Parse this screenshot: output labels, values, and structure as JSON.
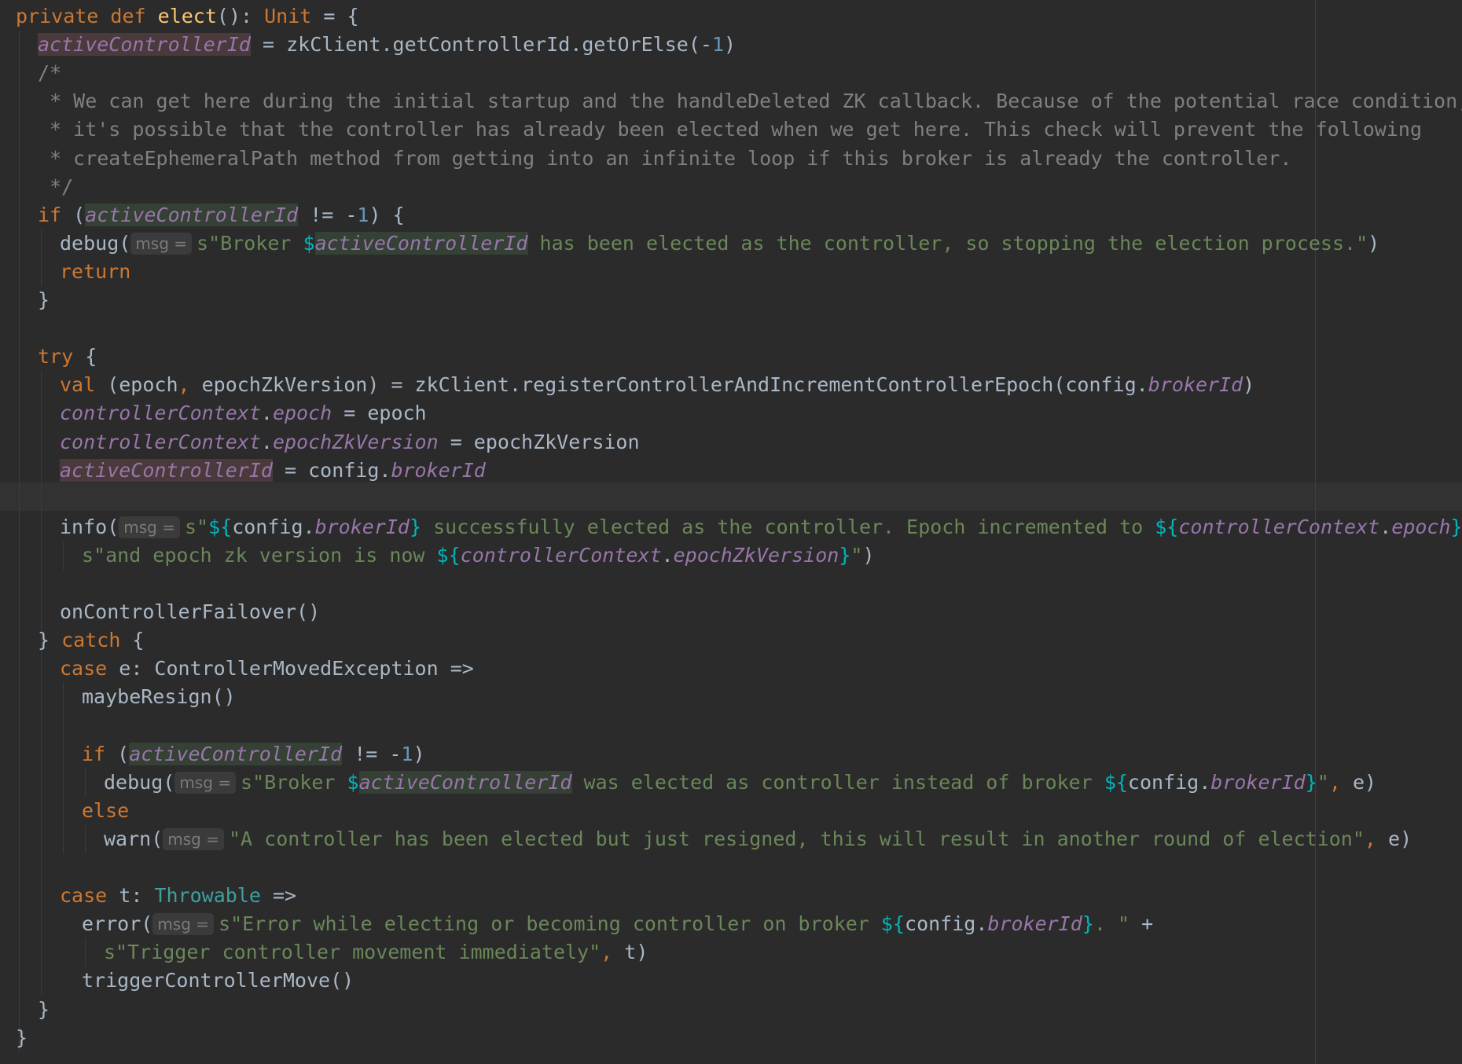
{
  "editor": {
    "lines": [
      {
        "indent": 0,
        "tokens": [
          {
            "t": "private ",
            "c": "kw"
          },
          {
            "t": "def ",
            "c": "kw"
          },
          {
            "t": "elect",
            "c": "fn"
          },
          {
            "t": "(): "
          },
          {
            "t": "Unit",
            "c": "kw"
          },
          {
            "t": " = {"
          }
        ]
      },
      {
        "indent": 1,
        "tokens": [
          {
            "t": "activeControllerId",
            "c": "fld hl-write"
          },
          {
            "t": " = zkClient.getControllerId.getOrElse(-"
          },
          {
            "t": "1",
            "c": "num"
          },
          {
            "t": ")"
          }
        ]
      },
      {
        "indent": 1,
        "tokens": [
          {
            "t": "/*",
            "c": "cmt"
          }
        ]
      },
      {
        "indent": 1,
        "tokens": [
          {
            "t": " * We can get here during the initial startup and the handleDeleted ZK callback. Because of the potential race condition,",
            "c": "cmt"
          }
        ]
      },
      {
        "indent": 1,
        "tokens": [
          {
            "t": " * it's possible that the controller has already been elected when we get here. This check will prevent the following",
            "c": "cmt"
          }
        ]
      },
      {
        "indent": 1,
        "tokens": [
          {
            "t": " * createEphemeralPath method from getting into an infinite loop if this broker is already the controller.",
            "c": "cmt"
          }
        ]
      },
      {
        "indent": 1,
        "tokens": [
          {
            "t": " */",
            "c": "cmt"
          }
        ]
      },
      {
        "indent": 1,
        "tokens": [
          {
            "t": "if",
            "c": "kw"
          },
          {
            "t": " ("
          },
          {
            "t": "activeControllerId",
            "c": "fld hl-read"
          },
          {
            "t": " != -"
          },
          {
            "t": "1",
            "c": "num"
          },
          {
            "t": ") {"
          }
        ]
      },
      {
        "indent": 2,
        "tokens": [
          {
            "t": "debug("
          },
          {
            "hint": "msg ="
          },
          {
            "t": "s\"Broker ",
            "c": "str"
          },
          {
            "t": "$",
            "c": "tpl"
          },
          {
            "t": "activeControllerId",
            "c": "fld hl-read"
          },
          {
            "t": " has been elected as the controller, so stopping the election process.\"",
            "c": "str"
          },
          {
            "t": ")"
          }
        ]
      },
      {
        "indent": 2,
        "tokens": [
          {
            "t": "return",
            "c": "kw"
          }
        ]
      },
      {
        "indent": 1,
        "tokens": [
          {
            "t": "}"
          }
        ]
      },
      {
        "indent": 0,
        "tokens": []
      },
      {
        "indent": 1,
        "tokens": [
          {
            "t": "try",
            "c": "kw"
          },
          {
            "t": " {"
          }
        ]
      },
      {
        "indent": 2,
        "tokens": [
          {
            "t": "val",
            "c": "kw"
          },
          {
            "t": " (epoch"
          },
          {
            "t": ",",
            "c": "kw"
          },
          {
            "t": " epochZkVersion) = zkClient.registerControllerAndIncrementControllerEpoch(config."
          },
          {
            "t": "brokerId",
            "c": "fld"
          },
          {
            "t": ")"
          }
        ]
      },
      {
        "indent": 2,
        "tokens": [
          {
            "t": "controllerContext",
            "c": "fld"
          },
          {
            "t": "."
          },
          {
            "t": "epoch",
            "c": "fld"
          },
          {
            "t": " = epoch"
          }
        ]
      },
      {
        "indent": 2,
        "tokens": [
          {
            "t": "controllerContext",
            "c": "fld"
          },
          {
            "t": "."
          },
          {
            "t": "epochZkVersion",
            "c": "fld"
          },
          {
            "t": " = epochZkVersion"
          }
        ]
      },
      {
        "indent": 2,
        "tokens": [
          {
            "t": "activeControllerId",
            "c": "fld hl-write"
          },
          {
            "t": " = config."
          },
          {
            "t": "brokerId",
            "c": "fld"
          }
        ]
      },
      {
        "indent": 0,
        "tokens": []
      },
      {
        "indent": 2,
        "tokens": [
          {
            "t": "info("
          },
          {
            "hint": "msg ="
          },
          {
            "t": "s\"",
            "c": "str"
          },
          {
            "t": "${",
            "c": "tpl"
          },
          {
            "t": "config."
          },
          {
            "t": "brokerId",
            "c": "fld"
          },
          {
            "t": "}",
            "c": "tpl"
          },
          {
            "t": " successfully elected as the controller. Epoch incremented to ",
            "c": "str"
          },
          {
            "t": "${",
            "c": "tpl"
          },
          {
            "t": "controllerContext",
            "c": "fld"
          },
          {
            "t": "."
          },
          {
            "t": "epoch",
            "c": "fld"
          },
          {
            "t": "}",
            "c": "tpl"
          },
          {
            "t": " \"",
            "c": "str"
          },
          {
            "t": " +"
          }
        ]
      },
      {
        "indent": 3,
        "tokens": [
          {
            "t": "s\"and epoch zk version is now ",
            "c": "str"
          },
          {
            "t": "${",
            "c": "tpl"
          },
          {
            "t": "controllerContext",
            "c": "fld"
          },
          {
            "t": "."
          },
          {
            "t": "epochZkVersion",
            "c": "fld"
          },
          {
            "t": "}",
            "c": "tpl"
          },
          {
            "t": "\"",
            "c": "str"
          },
          {
            "t": ")"
          }
        ]
      },
      {
        "indent": 0,
        "tokens": []
      },
      {
        "indent": 2,
        "tokens": [
          {
            "t": "onControllerFailover()"
          }
        ]
      },
      {
        "indent": 1,
        "tokens": [
          {
            "t": "} "
          },
          {
            "t": "catch",
            "c": "kw"
          },
          {
            "t": " {"
          }
        ]
      },
      {
        "indent": 2,
        "tokens": [
          {
            "t": "case",
            "c": "kw"
          },
          {
            "t": " e: ControllerMovedException =>"
          }
        ]
      },
      {
        "indent": 3,
        "tokens": [
          {
            "t": "maybeResign()"
          }
        ]
      },
      {
        "indent": 0,
        "tokens": []
      },
      {
        "indent": 3,
        "tokens": [
          {
            "t": "if",
            "c": "kw"
          },
          {
            "t": " ("
          },
          {
            "t": "activeControllerId",
            "c": "fld hl-read"
          },
          {
            "t": " != -"
          },
          {
            "t": "1",
            "c": "num"
          },
          {
            "t": ")"
          }
        ]
      },
      {
        "indent": 4,
        "tokens": [
          {
            "t": "debug("
          },
          {
            "hint": "msg ="
          },
          {
            "t": "s\"Broker ",
            "c": "str"
          },
          {
            "t": "$",
            "c": "tpl"
          },
          {
            "t": "activeControllerId",
            "c": "fld hl-read"
          },
          {
            "t": " was elected as controller instead of broker ",
            "c": "str"
          },
          {
            "t": "${",
            "c": "tpl"
          },
          {
            "t": "config."
          },
          {
            "t": "brokerId",
            "c": "fld"
          },
          {
            "t": "}",
            "c": "tpl"
          },
          {
            "t": "\"",
            "c": "str"
          },
          {
            "t": ",",
            "c": "kw"
          },
          {
            "t": " e)"
          }
        ]
      },
      {
        "indent": 3,
        "tokens": [
          {
            "t": "else",
            "c": "kw"
          }
        ]
      },
      {
        "indent": 4,
        "tokens": [
          {
            "t": "warn("
          },
          {
            "hint": "msg ="
          },
          {
            "t": "\"A controller has been elected but just resigned, this will result in another round of election\"",
            "c": "str"
          },
          {
            "t": ",",
            "c": "kw"
          },
          {
            "t": " e)"
          }
        ]
      },
      {
        "indent": 0,
        "tokens": []
      },
      {
        "indent": 2,
        "tokens": [
          {
            "t": "case",
            "c": "kw"
          },
          {
            "t": " t: "
          },
          {
            "t": "Throwable",
            "c": "thr"
          },
          {
            "t": " =>"
          }
        ]
      },
      {
        "indent": 3,
        "tokens": [
          {
            "t": "error("
          },
          {
            "hint": "msg ="
          },
          {
            "t": "s\"Error while electing or becoming controller on broker ",
            "c": "str"
          },
          {
            "t": "${",
            "c": "tpl"
          },
          {
            "t": "config."
          },
          {
            "t": "brokerId",
            "c": "fld"
          },
          {
            "t": "}",
            "c": "tpl"
          },
          {
            "t": ". \"",
            "c": "str"
          },
          {
            "t": " +"
          }
        ]
      },
      {
        "indent": 4,
        "tokens": [
          {
            "t": "s\"Trigger controller movement immediately\"",
            "c": "str"
          },
          {
            "t": ",",
            "c": "kw"
          },
          {
            "t": " t)"
          }
        ]
      },
      {
        "indent": 3,
        "tokens": [
          {
            "t": "triggerControllerMove()"
          }
        ]
      },
      {
        "indent": 1,
        "tokens": [
          {
            "t": "}"
          }
        ]
      },
      {
        "indent": 0,
        "tokens": [
          {
            "t": "}"
          }
        ]
      }
    ]
  }
}
